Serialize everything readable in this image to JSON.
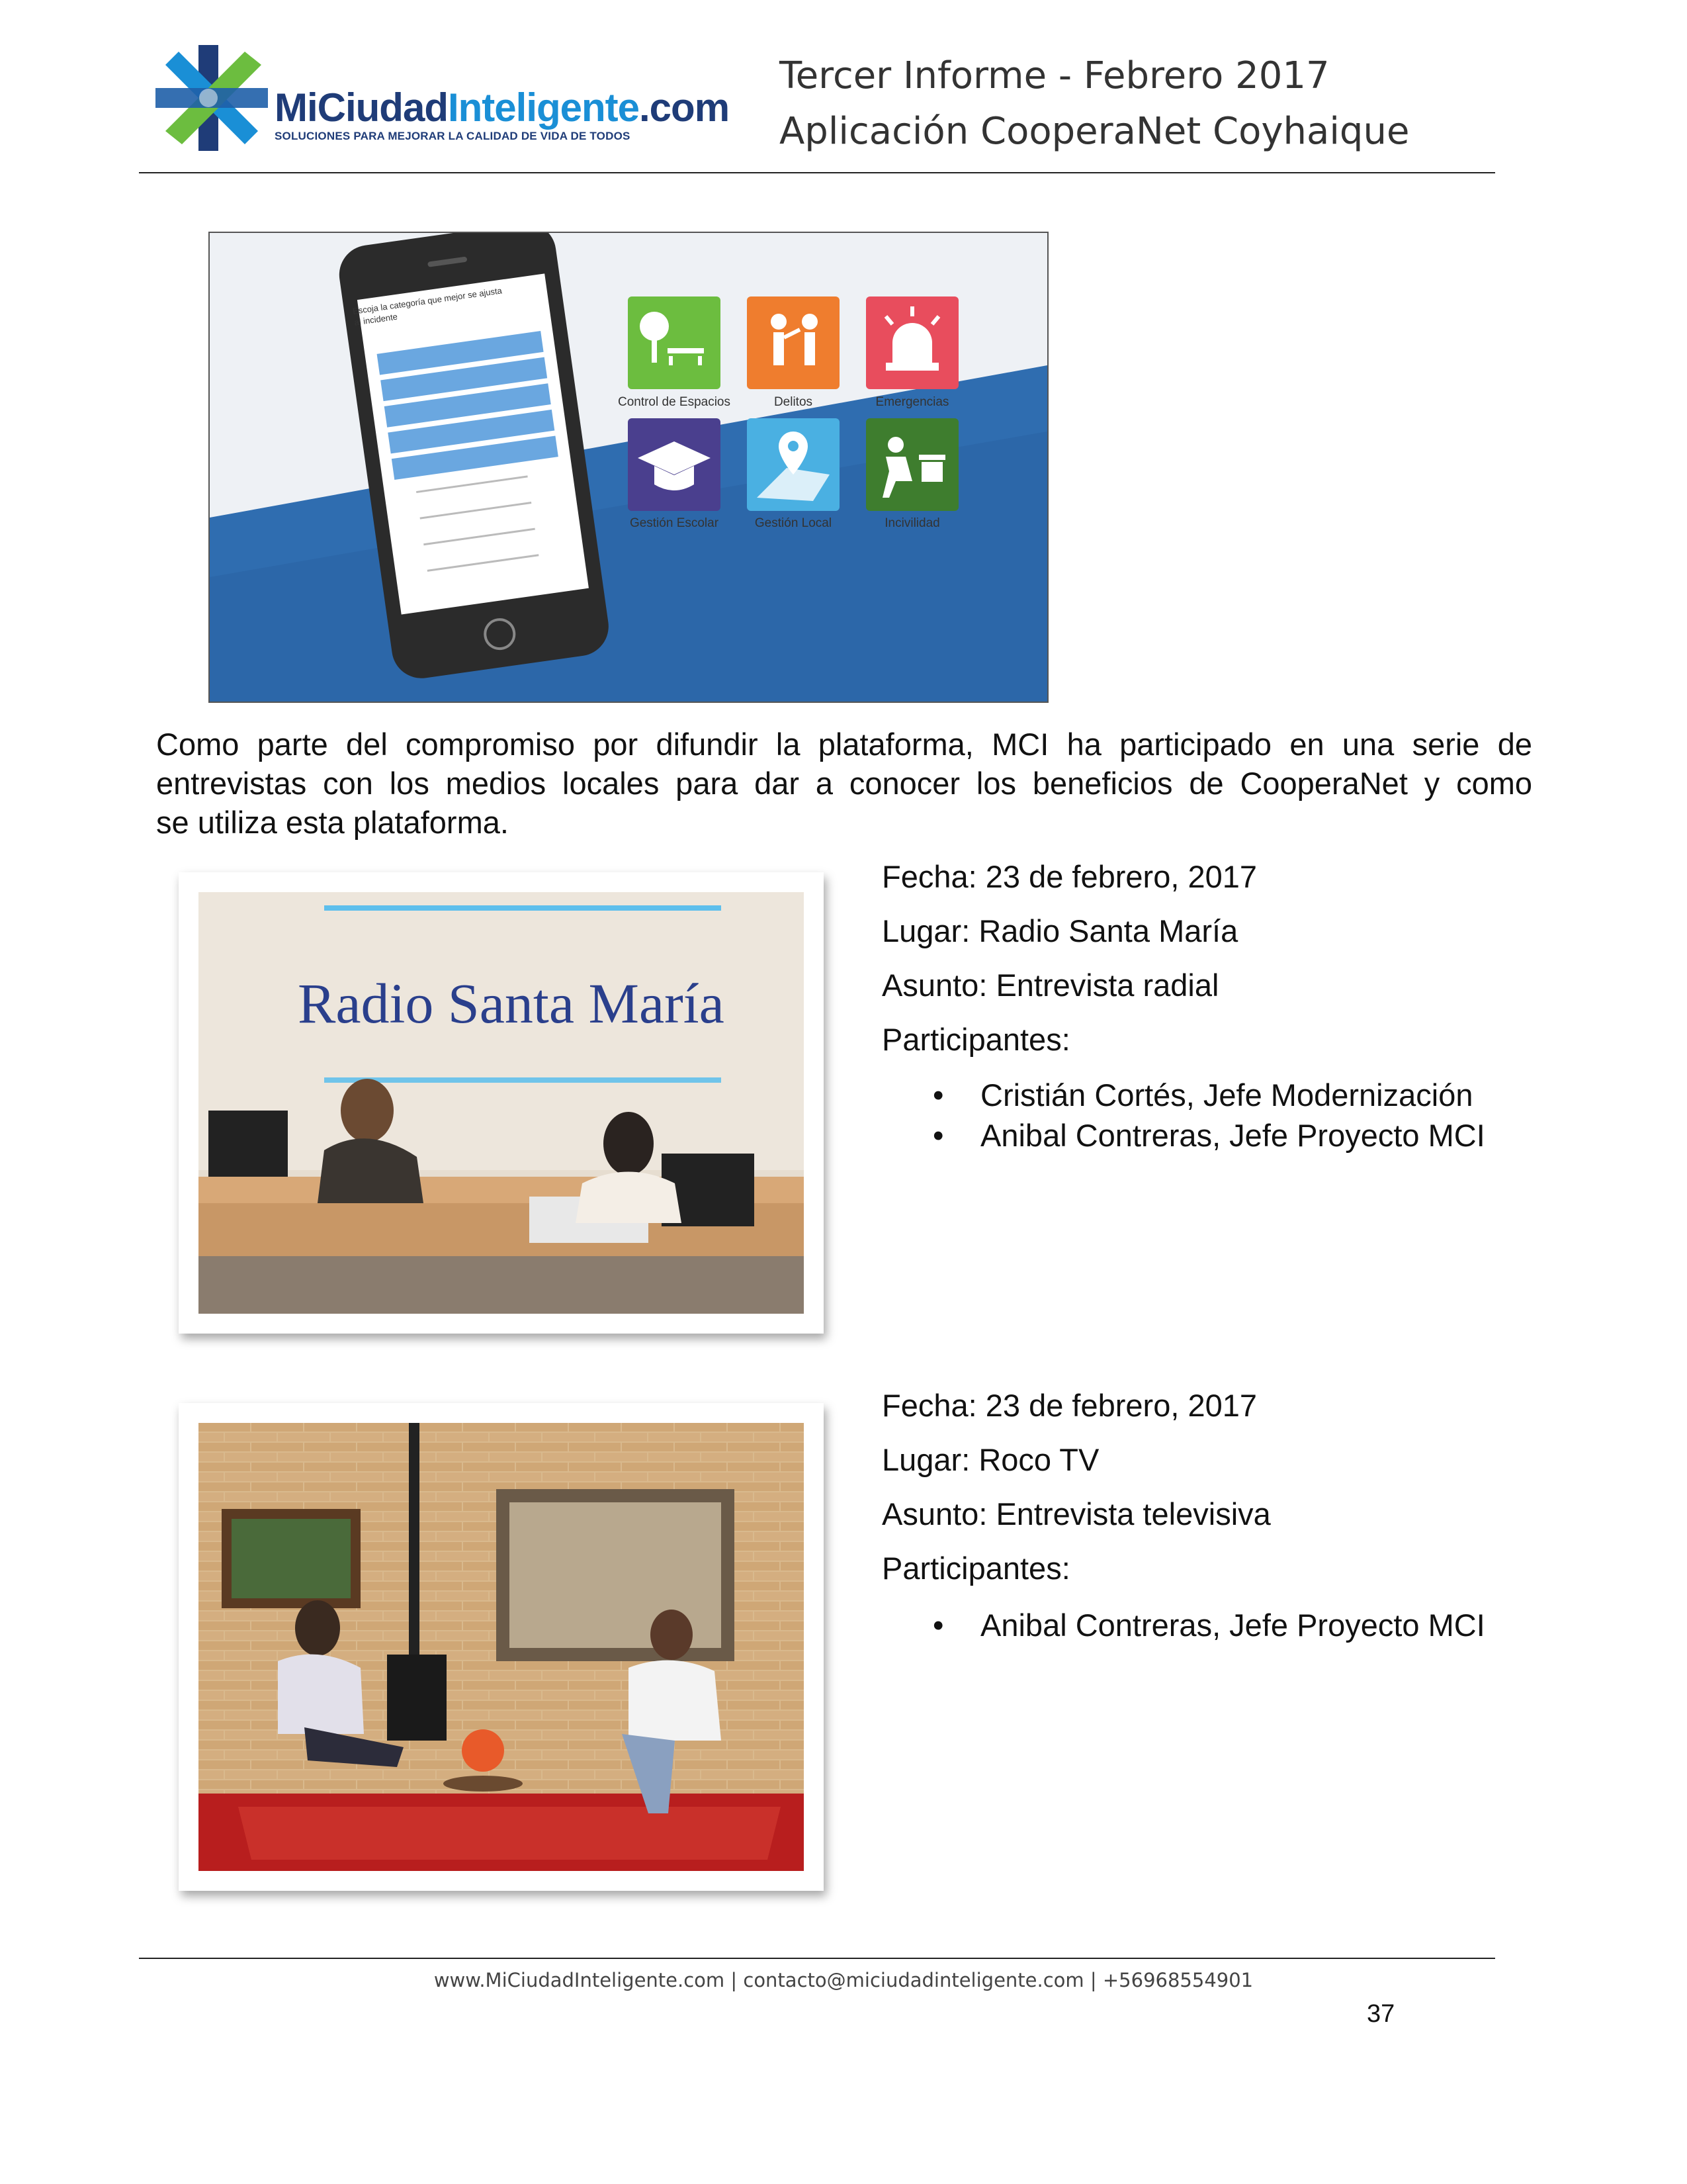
{
  "header": {
    "logo_name": "MiCiudadInteligente.com",
    "logo_name_main": "MiCiudad",
    "logo_name_accent": "Inteligente",
    "logo_name_tld": ".com",
    "logo_tagline": "SOLUCIONES PARA MEJORAR LA CALIDAD DE VIDA DE TODOS",
    "title_line1": "Tercer Informe - Febrero 2017",
    "title_line2": "Aplicación CooperaNet Coyhaique"
  },
  "app_screenshot": {
    "phone_prompt_line1": "Escoja la categoría que mejor se ajusta",
    "phone_prompt_line2": "al incidente",
    "tiles": [
      {
        "label": "Control de Espacios",
        "color": "#6cbd3f"
      },
      {
        "label": "Delitos",
        "color": "#ef7d2e"
      },
      {
        "label": "Emergencias",
        "color": "#e84d5d"
      },
      {
        "label": "Gestión Escolar",
        "color": "#4a3f8e"
      },
      {
        "label": "Gestión Local",
        "color": "#4ab0e2"
      },
      {
        "label": "Incivilidad",
        "color": "#3e7d2e"
      }
    ]
  },
  "intro": {
    "line1": "Como parte del compromiso por difundir la plataforma, MCI ha participado en una serie de",
    "line2": "entrevistas con los medios locales para dar a conocer los beneficios de CooperaNet y como",
    "line3": "se utiliza esta plataforma."
  },
  "interviews": [
    {
      "fecha": "Fecha: 23 de febrero, 2017",
      "lugar": "Lugar: Radio Santa María",
      "asunto": "Asunto: Entrevista radial",
      "participantes_label": "Participantes:",
      "participantes": [
        "Cristián Cortés, Jefe Modernización",
        "Anibal Contreras, Jefe Proyecto MCI"
      ],
      "photo_sign": "Radio Santa María"
    },
    {
      "fecha": "Fecha: 23 de febrero, 2017",
      "lugar": "Lugar: Roco TV",
      "asunto": "Asunto: Entrevista televisiva",
      "participantes_label": "Participantes:",
      "participantes": [
        "Anibal Contreras, Jefe Proyecto MCI"
      ]
    }
  ],
  "footer": {
    "text": "www.MiCiudadInteligente.com | contacto@miciudadinteligente.com | +56968554901",
    "page_number": "37"
  },
  "bullet_glyph": "•"
}
